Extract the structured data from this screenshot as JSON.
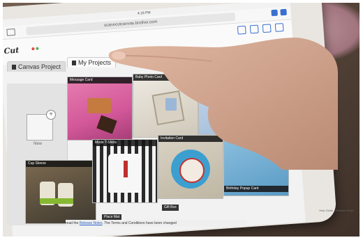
{
  "statusbar": {
    "time": "4:18 PM",
    "battery": ""
  },
  "browser": {
    "url": "scanncutcanvas.brother.com"
  },
  "app": {
    "logo_text": "Cut"
  },
  "tabs": {
    "canvas_project": "Canvas Project",
    "my_projects": "My Projects"
  },
  "new_project": {
    "label": "New"
  },
  "tiles": [
    {
      "label": "Message Card"
    },
    {
      "label": "Baby Photo Card"
    },
    {
      "label": "Cup Sleeve"
    },
    {
      "label": "Mode T-Shirts"
    },
    {
      "label": "Invitation Card"
    },
    {
      "label": "Place Mat"
    },
    {
      "label": "Gift Box"
    },
    {
      "label": "Birthday Popup Card"
    }
  ],
  "notice": {
    "prefix": "read the",
    "link": "Release Notes",
    "suffix": "The Terms and Conditions have been changed"
  },
  "footer_links": {
    "left": "Help Guide",
    "right": "Release Notes"
  },
  "colors": {
    "accent": "#3a6fd0",
    "pink_tile": "#d3589a"
  }
}
